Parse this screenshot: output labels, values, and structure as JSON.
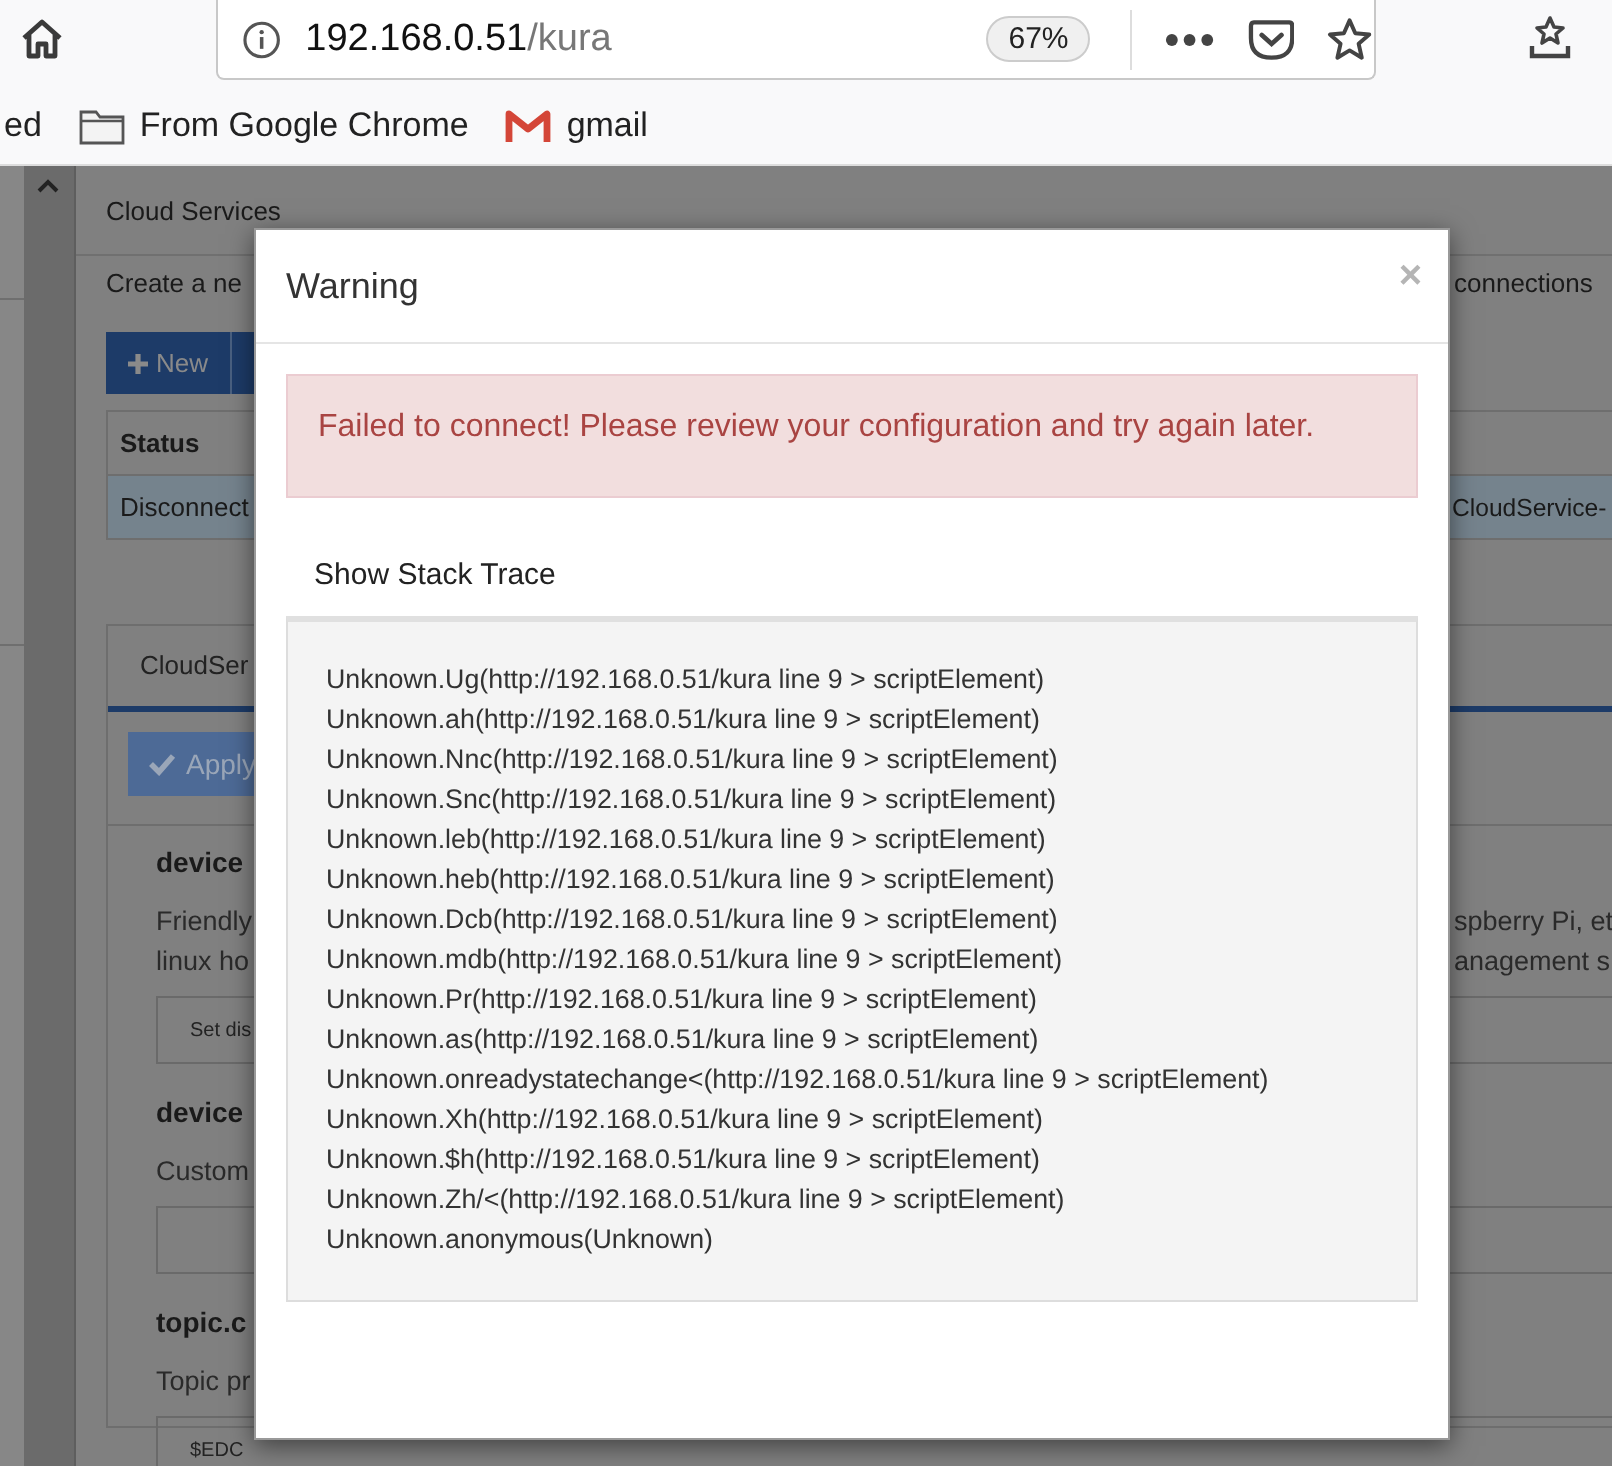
{
  "browser": {
    "url_host": "192.168.0.51",
    "url_path": "/kura",
    "zoom": "67%"
  },
  "bookmarks": [
    {
      "label": "ed",
      "kind": "plain"
    },
    {
      "label": "From Google Chrome",
      "kind": "folder"
    },
    {
      "label": "gmail",
      "kind": "gmail"
    }
  ],
  "page": {
    "heading": "Cloud Services",
    "description_left": "Create a ne",
    "description_right": "connections",
    "new_button": "New",
    "table": {
      "header": "Status",
      "rows": [
        {
          "left": "Disconnect",
          "right": "CloudService-",
          "selected": true
        }
      ]
    },
    "tabs": [
      {
        "label": "CloudSer",
        "selected": true
      }
    ],
    "apply_button": {
      "label": "Apply",
      "disabled": true
    },
    "fields": [
      {
        "title": "device",
        "left_lines": [
          "Friendly",
          "linux ho"
        ],
        "right_lines": [
          "spberry Pi, et",
          "anagement s"
        ],
        "value": "Set dis"
      },
      {
        "title": "device",
        "left_lines": [
          "Custom"
        ]
      },
      {
        "title": "topic.c",
        "left_lines": [
          "Topic pr"
        ],
        "value": "$EDC"
      }
    ]
  },
  "modal": {
    "title": "Warning",
    "close": "×",
    "alert": "Failed to connect! Please review your configuration and try again later.",
    "stack_label": "Show Stack Trace",
    "stack": [
      "Unknown.Ug(http://192.168.0.51/kura line 9 > scriptElement)",
      "Unknown.ah(http://192.168.0.51/kura line 9 > scriptElement)",
      "Unknown.Nnc(http://192.168.0.51/kura line 9 > scriptElement)",
      "Unknown.Snc(http://192.168.0.51/kura line 9 > scriptElement)",
      "Unknown.leb(http://192.168.0.51/kura line 9 > scriptElement)",
      "Unknown.heb(http://192.168.0.51/kura line 9 > scriptElement)",
      "Unknown.Dcb(http://192.168.0.51/kura line 9 > scriptElement)",
      "Unknown.mdb(http://192.168.0.51/kura line 9 > scriptElement)",
      "Unknown.Pr(http://192.168.0.51/kura line 9 > scriptElement)",
      "Unknown.as(http://192.168.0.51/kura line 9 > scriptElement)",
      "Unknown.onreadystatechange<(http://192.168.0.51/kura line 9 > scriptElement)",
      "Unknown.Xh(http://192.168.0.51/kura line 9 > scriptElement)",
      "Unknown.$h(http://192.168.0.51/kura line 9 > scriptElement)",
      "Unknown.Zh/<(http://192.168.0.51/kura line 9 > scriptElement)",
      "Unknown.anonymous(Unknown)"
    ]
  }
}
